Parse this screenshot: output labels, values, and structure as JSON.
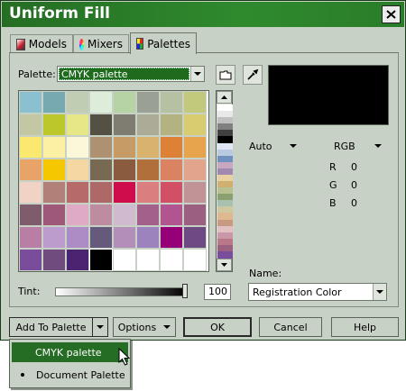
{
  "window": {
    "title": "Uniform Fill"
  },
  "tabs": [
    {
      "label": "Models"
    },
    {
      "label": "Mixers"
    },
    {
      "label": "Palettes"
    }
  ],
  "palette": {
    "label": "Palette:",
    "selected": "CMYK palette",
    "swatches": [
      "#8ac0cf",
      "#76aab0",
      "#c1cdb2",
      "#deecda",
      "#b6d3a6",
      "#9ba094",
      "#b6c0a2",
      "#c2c87c",
      "#c4c7a3",
      "#bcc829",
      "#e8e787",
      "#545044",
      "#7f7c71",
      "#acab97",
      "#b3b280",
      "#d7cc70",
      "#fae86f",
      "#fbf0a4",
      "#fcf7d8",
      "#ae9171",
      "#c69b66",
      "#d9b36d",
      "#dd8136",
      "#e7a44c",
      "#e7a368",
      "#f5c700",
      "#f5d7a1",
      "#786a52",
      "#8b5b40",
      "#b1703b",
      "#db8262",
      "#e2a48a",
      "#f0d3c4",
      "#b08079",
      "#b66b69",
      "#ae6868",
      "#cf0c4c",
      "#da7e7f",
      "#d25066",
      "#c19296",
      "#7e5c6c",
      "#9e5878",
      "#dfaac4",
      "#bd8ca1",
      "#cfbad0",
      "#a2608b",
      "#b2548f",
      "#9b6081",
      "#b97ea5",
      "#bc9ccc",
      "#ad8bc4",
      "#655a7c",
      "#b38eb8",
      "#9c83bd",
      "#950079",
      "#6d4b82",
      "#7a4c9c",
      "#6f4b7e",
      "#4a2470",
      "#000000",
      "#ffffff",
      "#ffffff",
      "#ffffff",
      "#ffffff"
    ]
  },
  "color_mode": {
    "left": "Auto",
    "right": "RGB"
  },
  "rgb": [
    {
      "label": "R",
      "value": "0"
    },
    {
      "label": "G",
      "value": "0"
    },
    {
      "label": "B",
      "value": "0"
    }
  ],
  "name_field": {
    "label": "Name:",
    "value": "Registration Color"
  },
  "tint": {
    "label": "Tint:",
    "value": "100",
    "fraction": 1.0
  },
  "buttons": {
    "add_to_palette": "Add To Palette",
    "options": "Options",
    "ok": "OK",
    "cancel": "Cancel",
    "help": "Help"
  },
  "dropdown_menu": {
    "items": [
      "CMYK palette",
      "Document Palette"
    ]
  },
  "accent": "#256d24"
}
